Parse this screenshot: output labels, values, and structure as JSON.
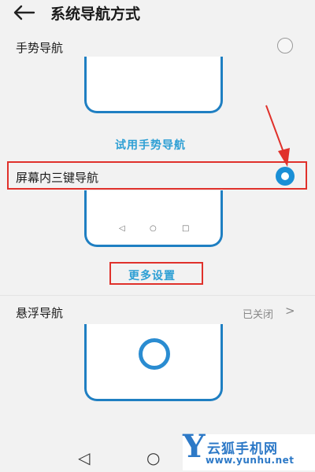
{
  "header": {
    "title": "系统导航方式",
    "back_icon": "arrow-left-icon"
  },
  "gesture_nav": {
    "label": "手势导航",
    "selected": false,
    "try_link": "试用手势导航"
  },
  "three_key_nav": {
    "label": "屏幕内三键导航",
    "selected": true,
    "more_settings": "更多设置",
    "buttons": [
      "◁",
      "○",
      "□"
    ]
  },
  "float_nav": {
    "label": "悬浮导航",
    "status": "已关闭",
    "chevron": ">"
  },
  "system_nav_bar": {
    "back": "◁",
    "home": "○",
    "recent": "□"
  },
  "watermark": {
    "logo_letter": "Y",
    "site_name": "云狐手机网",
    "url": "www.yunhu.net"
  },
  "colors": {
    "accent": "#1a8fd6",
    "phone_outline": "#1f7fc2",
    "highlight": "#e0312b",
    "link": "#2d9fd4"
  }
}
